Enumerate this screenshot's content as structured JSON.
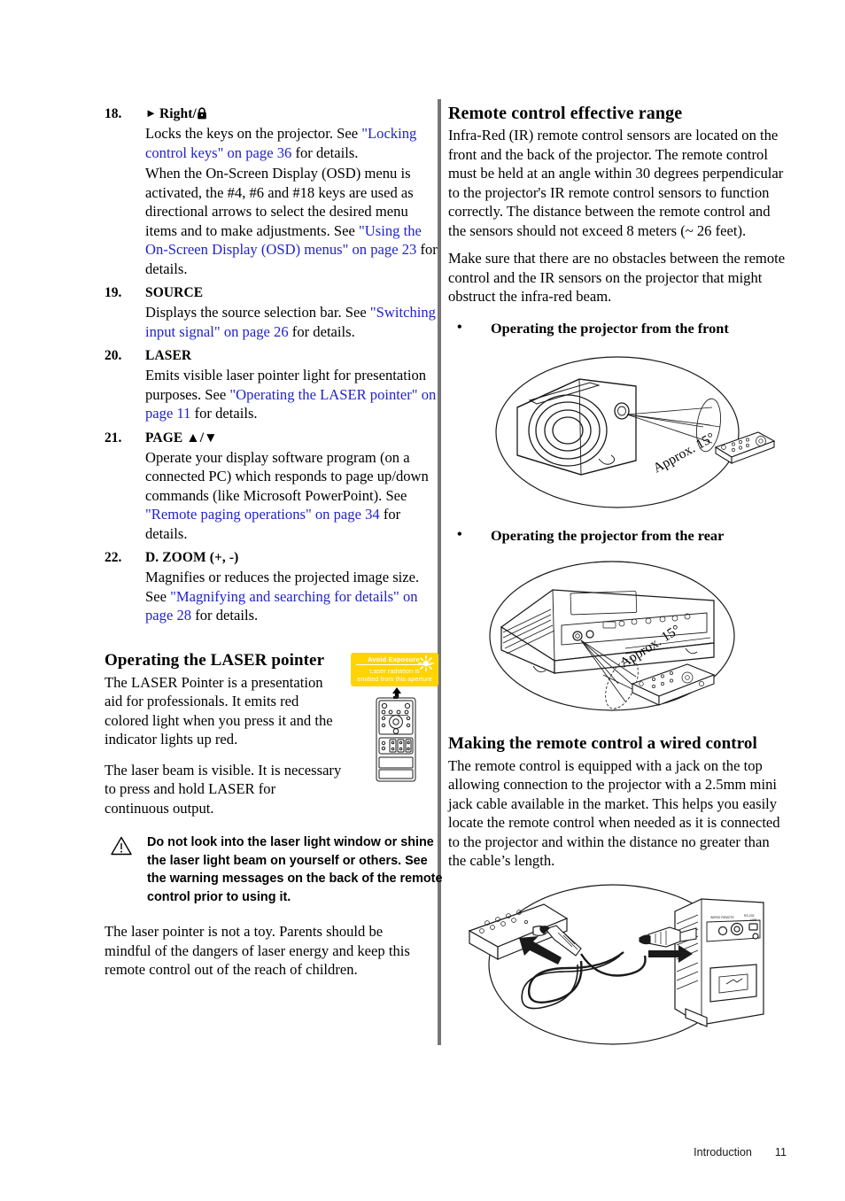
{
  "document": {
    "footer": {
      "section": "Introduction",
      "page_number": "11"
    },
    "link_color": "#2222cc",
    "sticker_color": "#ffd400",
    "divider_color": "#767676"
  },
  "left_column": {
    "list": [
      {
        "number": "18.",
        "term_prefix": "Right/",
        "term_icons": [
          "triangle-right-icon",
          "lock-icon"
        ],
        "paragraphs": [
          {
            "runs": [
              {
                "t": "Locks the keys on the projector. See ",
                "link": false
              },
              {
                "t": "\"Locking control keys\" on page 36",
                "link": true
              },
              {
                "t": " for details.",
                "link": false
              }
            ]
          },
          {
            "runs": [
              {
                "t": "When the On-Screen Display (OSD) menu is activated, the #4, #6 and #18 keys are used as directional arrows to select the desired menu items and to make adjustments. See ",
                "link": false
              },
              {
                "t": "\"Using the On-Screen Display (OSD) menus\" on page 23",
                "link": true
              },
              {
                "t": " for details.",
                "link": false
              }
            ]
          }
        ]
      },
      {
        "number": "19.",
        "term": "SOURCE",
        "paragraphs": [
          {
            "runs": [
              {
                "t": "Displays the source selection bar. See ",
                "link": false
              },
              {
                "t": "\"Switching input signal\" on page 26",
                "link": true
              },
              {
                "t": " for details.",
                "link": false
              }
            ]
          }
        ]
      },
      {
        "number": "20.",
        "term": "LASER",
        "paragraphs": [
          {
            "runs": [
              {
                "t": "Emits visible laser pointer light for presentation purposes. See ",
                "link": false
              },
              {
                "t": "\"Operating the LASER pointer\" on page 11",
                "link": true
              },
              {
                "t": " for details.",
                "link": false
              }
            ]
          }
        ]
      },
      {
        "number": "21.",
        "term": "PAGE ▲/▼",
        "paragraphs": [
          {
            "runs": [
              {
                "t": "Operate your display software program (on a connected PC) which responds to page up/down commands (like Microsoft PowerPoint). See ",
                "link": false
              },
              {
                "t": "\"Remote paging operations\" on page 34",
                "link": true
              },
              {
                "t": " for details.",
                "link": false
              }
            ]
          }
        ]
      },
      {
        "number": "22.",
        "term": "D. ZOOM (+, -)",
        "paragraphs": [
          {
            "runs": [
              {
                "t": "Magnifies or reduces the projected image size. See ",
                "link": false
              },
              {
                "t": "\"Magnifying and searching for details\" on page 28",
                "link": true
              },
              {
                "t": " for details.",
                "link": false
              }
            ]
          }
        ]
      }
    ],
    "laser_section": {
      "heading": "Operating the LASER pointer",
      "paragraph1": "The LASER Pointer is a presentation aid for professionals. It emits red colored light when you press it and the indicator lights up red.",
      "paragraph2": "The laser beam is visible. It is necessary to press and hold LASER for continuous output.",
      "warning": "Do not look into the laser light window or shine the laser light beam on yourself or others. See the warning messages on the back of the remote control prior to using it.",
      "paragraph3": "The laser pointer is not a toy. Parents should be mindful of the dangers of laser energy and keep this remote control out of the reach of children."
    },
    "sticker": {
      "line1": "Avoid Exposure",
      "line2": "Laser radiation is",
      "line3": "emitted from this aperture"
    }
  },
  "right_column": {
    "range_section": {
      "heading": "Remote control effective range",
      "paragraph1": "Infra-Red (IR) remote control sensors are located on the front and the back of the projector. The remote control must be held at an angle within 30 degrees perpendicular to the projector's IR remote control sensors to function correctly. The distance between the remote control and the sensors should not exceed 8 meters (~ 26 feet).",
      "paragraph2": "Make sure that there are no obstacles between the remote control and the IR sensors on the projector that might obstruct the infra-red beam.",
      "bullet1": "Operating the projector from the front",
      "bullet2": "Operating the projector from the rear",
      "figure1_label": "Approx. 15°",
      "figure2_label": "Approx. 15°"
    },
    "wired_section": {
      "heading": "Making the remote control a wired control",
      "paragraph1": "The remote control is equipped with a jack on the top allowing connection to the projector with a 2.5mm mini jack cable available in the market. This helps you easily locate the remote control when needed as it is connected to the projector and within the distance no greater than the cable’s length."
    }
  }
}
